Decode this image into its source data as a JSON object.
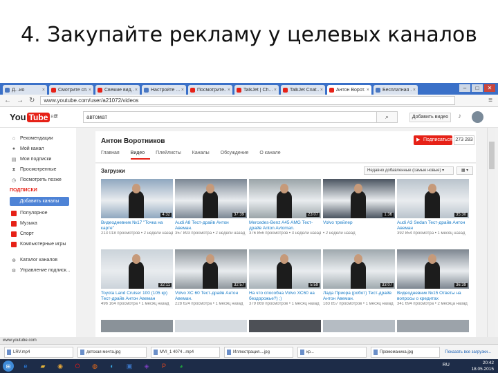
{
  "slide": {
    "title": "4. Закупайте рекламу у целевых каналов"
  },
  "browser": {
    "tabs": [
      {
        "label": "Д...ио",
        "color": "#4a78c2"
      },
      {
        "label": "Смотрите сп...",
        "color": "#e62117"
      },
      {
        "label": "Свежие вид...",
        "color": "#e62117"
      },
      {
        "label": "Настройте ...",
        "color": "#4a78c2"
      },
      {
        "label": "Посмотрите...",
        "color": "#e62117"
      },
      {
        "label": "TalkJet | Ch...",
        "color": "#e62117"
      },
      {
        "label": "TalkJet Cnat...",
        "color": "#e62117"
      },
      {
        "label": "Антон Ворот...",
        "color": "#e62117",
        "active": true
      },
      {
        "label": "Бесплатная ...",
        "color": "#4a78c2"
      }
    ],
    "address": "www.youtube.com/user/a21072/videos",
    "window_controls": {
      "minimize": "–",
      "maximize": "□",
      "close": "✕"
    }
  },
  "youtube": {
    "logo_you": "You",
    "logo_tube": "Tube",
    "logo_region": "RU",
    "search_value": "автомат",
    "upload_label": "Добавить видео",
    "sidebar": {
      "main": [
        {
          "label": "Рекомендации",
          "icon": "home-icon",
          "glyph": "⌂"
        },
        {
          "label": "Мой канал",
          "icon": "user-icon",
          "glyph": "●"
        },
        {
          "label": "Мои подписки",
          "icon": "subscriptions-icon",
          "glyph": "▤"
        },
        {
          "label": "Просмотренные",
          "icon": "history-icon",
          "glyph": "⧗"
        },
        {
          "label": "Посмотреть позже",
          "icon": "clock-icon",
          "glyph": "◷"
        }
      ],
      "subscriptions_header": "ПОДПИСКИ",
      "add_channels": "Добавить каналы",
      "subscriptions": [
        {
          "label": "Популярное",
          "color": "#e62117"
        },
        {
          "label": "Музыка",
          "color": "#e62117"
        },
        {
          "label": "Спорт",
          "color": "#e62117"
        },
        {
          "label": "Компьютерные игры",
          "color": "#e62117"
        }
      ],
      "bottom": [
        {
          "label": "Каталог каналов",
          "icon": "catalog-icon",
          "glyph": "⊕"
        },
        {
          "label": "Управление подписк...",
          "icon": "gear-icon",
          "glyph": "⚙"
        }
      ]
    },
    "channel": {
      "name": "Антон Воротников",
      "subscribe_label": "Подписаться",
      "subscriber_count": "273 283",
      "tabs": [
        "Главная",
        "Видео",
        "Плейлисты",
        "Каналы",
        "Обсуждение",
        "О канале"
      ],
      "active_tab": 1
    },
    "uploads": {
      "title": "Загрузки",
      "sort_label": "Недавно добавленные (самые новые) ▾",
      "view_label": "▦ ▾"
    },
    "videos_row1": [
      {
        "title": "Видеодневник №17 \"Точка на карте\"",
        "meta": "213 018 просмотров • 2 недели назад",
        "duration": "4:32",
        "bg": "#8fa7bf"
      },
      {
        "title": "Audi A8 Тест-драйв Антон Авеман.",
        "meta": "357 893 просмотра • 2 недели назад",
        "duration": "37:39",
        "bg": "#7b8794"
      },
      {
        "title": "Mercedes-Benz A45 AMG Тест-драйв Anton Avtoman.",
        "meta": "376 856 просмотров • 3 недели назад",
        "duration": "23:07",
        "bg": "#9aa4a8"
      },
      {
        "title": "Volvo трейлер",
        "meta": "• 2 недели назад",
        "duration": "1:36",
        "bg": "#4a5460"
      },
      {
        "title": "Audi A3 Sedan Тест-драйв Антон Авеман",
        "meta": "392 854 просмотра • 1 месяц назад",
        "duration": "35:30",
        "bg": "#b9c3cc"
      }
    ],
    "videos_row2": [
      {
        "title": "Toyota Land Cruiser 100 (105 кр) Тест-драйв Антон Авеман",
        "meta": "496 164 просмотра • 1 месяц назад",
        "duration": "32:11",
        "bg": "#cbd3da"
      },
      {
        "title": "Volvo XC 60 Тест-драйв Антон Авеман.",
        "meta": "228 624 просмотра • 1 месяц назад",
        "duration": "32:57",
        "bg": "#8e969c"
      },
      {
        "title": "На что способна Volvo XC60 на бездорожье?) ;)",
        "meta": "379 869 просмотров • 1 месяц назад",
        "duration": "5:59",
        "bg": "#a8b2b8"
      },
      {
        "title": "Лада Приора (робот) Тест-драйв Антон Авеман.",
        "meta": "183 857 просмотров • 1 месяц назад",
        "duration": "33:07",
        "bg": "#9fa9ae"
      },
      {
        "title": "Видеодневник №15 Ответы на вопросы о кредитах",
        "meta": "341 694 просмотра • 2 месяца назад",
        "duration": "36:39",
        "bg": "#7d8690"
      }
    ],
    "videos_row3": [
      {
        "bg": "#8a9299"
      },
      {
        "bg": "#d6dbe0"
      },
      {
        "bg": "#4d5056"
      },
      {
        "bg": "#b5bcc3"
      },
      {
        "bg": "#9ca3aa"
      }
    ]
  },
  "statusbar": {
    "text": "www.youtube.com"
  },
  "downloads": {
    "items": [
      "LRV.mp4",
      "детская мечта.jpg",
      "MVI_1 4074 ..mp4",
      "Иллюстрация....jpg",
      "кр...",
      "Промоманика.jpg"
    ],
    "show_all": "Показать все загрузки..."
  },
  "taskbar": {
    "apps": [
      {
        "glyph": "e",
        "color": "#2a7de1",
        "icon": "ie-icon"
      },
      {
        "glyph": "▰",
        "color": "#e3b33a",
        "icon": "folder-icon"
      },
      {
        "glyph": "◉",
        "color": "#e8a83a",
        "icon": "media-icon"
      },
      {
        "glyph": "O",
        "color": "#cc1b1b",
        "icon": "opera-icon"
      },
      {
        "glyph": "◍",
        "color": "#e66a19",
        "icon": "firefox-icon"
      },
      {
        "glyph": "◐",
        "color": "#3aa7e0",
        "icon": "app-icon"
      },
      {
        "glyph": "▣",
        "color": "#3a74c4",
        "icon": "monitor-icon"
      },
      {
        "glyph": "◈",
        "color": "#7b3fbf",
        "icon": "app2-icon"
      },
      {
        "glyph": "P",
        "color": "#d24625",
        "icon": "powerpoint-icon"
      },
      {
        "glyph": "◕",
        "color": "#1f9e3f",
        "icon": "chrome-icon"
      }
    ],
    "lang": "RU",
    "time": "20:42",
    "date": "18.05.2015"
  }
}
